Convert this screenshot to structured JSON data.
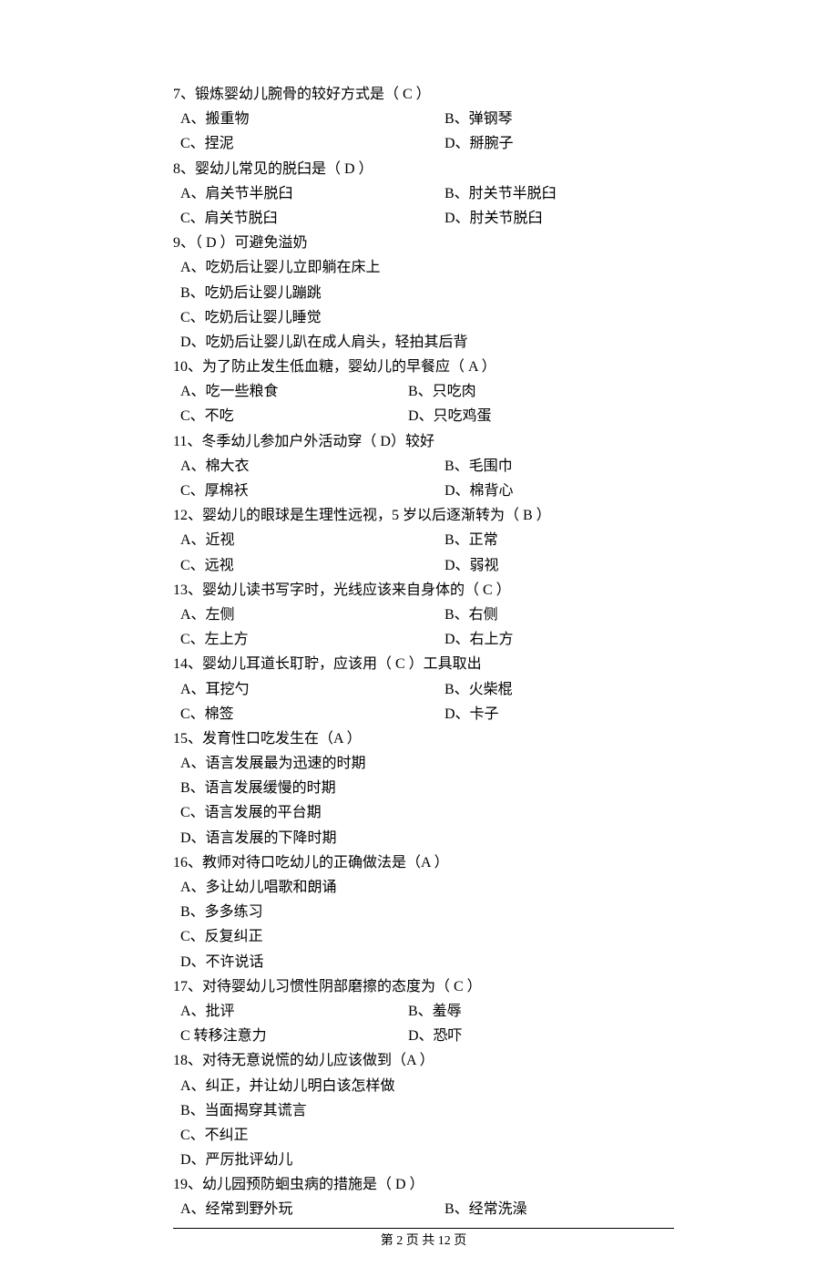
{
  "questions": [
    {
      "num": "7、",
      "stem": "锻炼婴幼儿腕骨的较好方式是（ C ）",
      "layout": "two-col",
      "a": "A、搬重物",
      "b": "B、弹钢琴",
      "c": "C、捏泥",
      "d": "D、掰腕子"
    },
    {
      "num": "8、",
      "stem": "婴幼儿常见的脱臼是（ D ）",
      "layout": "two-col",
      "a": "A、肩关节半脱臼",
      "b": "B、肘关节半脱臼",
      "c": "C、肩关节脱臼",
      "d": "D、肘关节脱臼"
    },
    {
      "num": "9、",
      "stem": "（ D ）可避免溢奶",
      "layout": "full",
      "a": "A、吃奶后让婴儿立即躺在床上",
      "b": "B、吃奶后让婴儿蹦跳",
      "c": "C、吃奶后让婴儿睡觉",
      "d": "D、吃奶后让婴儿趴在成人肩头，轻拍其后背"
    },
    {
      "num": "10、",
      "stem": "为了防止发生低血糖，婴幼儿的早餐应（ A ）",
      "layout": "two-col-wide1",
      "a": "A、吃一些粮食",
      "b": "B、只吃肉",
      "c": "C、不吃",
      "d": "D、只吃鸡蛋"
    },
    {
      "num": "11、",
      "stem": "冬季幼儿参加户外活动穿（  D）较好",
      "layout": "two-col",
      "a": "A、棉大衣",
      "b": "B、毛围巾",
      "c": "C、厚棉袄",
      "d": "D、棉背心"
    },
    {
      "num": "12、",
      "stem": "婴幼儿的眼球是生理性远视，5 岁以后逐渐转为（ B ）",
      "layout": "two-col",
      "a": "A、近视",
      "b": "B、正常",
      "c": "C、远视",
      "d": "D、弱视"
    },
    {
      "num": "13、",
      "stem": "婴幼儿读书写字时，光线应该来自身体的（ C ）",
      "layout": "two-col",
      "a": "A、左侧",
      "b": "B、右侧",
      "c": "C、左上方",
      "d": "D、右上方"
    },
    {
      "num": "14、",
      "stem": "婴幼儿耳道长耵聍，应该用（ C ）工具取出",
      "layout": "two-col",
      "a": "A、耳挖勺",
      "b": "B、火柴棍",
      "c": "C、棉签",
      "d": "D、卡子"
    },
    {
      "num": "15、",
      "stem": "发育性口吃发生在（A  ）",
      "layout": "full",
      "a": "A、语言发展最为迅速的时期",
      "b": "B、语言发展缓慢的时期",
      "c": "C、语言发展的平台期",
      "d": "D、语言发展的下降时期"
    },
    {
      "num": "16、",
      "stem": "教师对待口吃幼儿的正确做法是（A  ）",
      "layout": "full",
      "a": "A、多让幼儿唱歌和朗诵",
      "b": "B、多多练习",
      "c": "C、反复纠正",
      "d": "D、不许说话"
    },
    {
      "num": "17、",
      "stem": "对待婴幼儿习惯性阴部磨擦的态度为（ C ）",
      "layout": "two-col-wide1",
      "a": "A、批评",
      "b": "B、羞辱",
      "c": "C 转移注意力",
      "d": "D、恐吓"
    },
    {
      "num": "18、",
      "stem": "对待无意说慌的幼儿应该做到（A  ）",
      "layout": "full",
      "a": "A、纠正，并让幼儿明白该怎样做",
      "b": "B、当面揭穿其谎言",
      "c": "C、不纠正",
      "d": "D、严厉批评幼儿"
    },
    {
      "num": "19、",
      "stem": "幼儿园预防蛔虫病的措施是（ D ）",
      "layout": "two-col-only-ab",
      "a": "A、经常到野外玩",
      "b": "B、经常洗澡"
    }
  ],
  "footer": {
    "page_label": "第 2 页  共 12 页"
  }
}
